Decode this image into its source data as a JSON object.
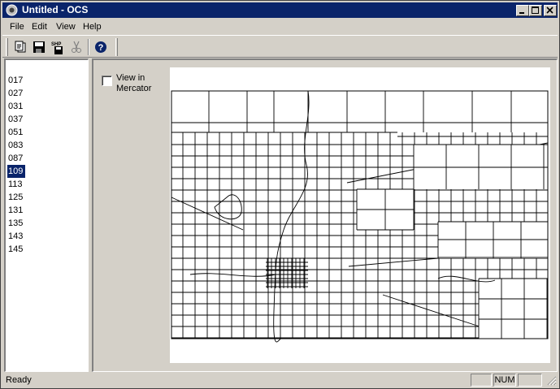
{
  "window": {
    "title": "Untitled - OCS"
  },
  "menu": [
    "File",
    "Edit",
    "View",
    "Help"
  ],
  "toolbar": {
    "buttons": [
      "new-document-icon",
      "save-icon",
      "save-shp-icon",
      "cut-icon",
      "help-icon"
    ],
    "shp_label": "SHP",
    "help_glyph": "?"
  },
  "county_list": {
    "items": [
      "017",
      "027",
      "031",
      "037",
      "051",
      "083",
      "087",
      "109",
      "113",
      "125",
      "131",
      "135",
      "143",
      "145"
    ],
    "selected": "109"
  },
  "mercator_checkbox": {
    "label": "View in Mercator",
    "checked": false
  },
  "map": {
    "selected_county_code": "109",
    "boundary_color": "#000000",
    "background_color": "#ffffff"
  },
  "statusbar": {
    "text": "Ready",
    "indicators": [
      "",
      "NUM",
      ""
    ]
  },
  "colors": {
    "titlebar": "#0a246a",
    "chrome": "#d4d0c8",
    "selection": "#0a246a"
  }
}
